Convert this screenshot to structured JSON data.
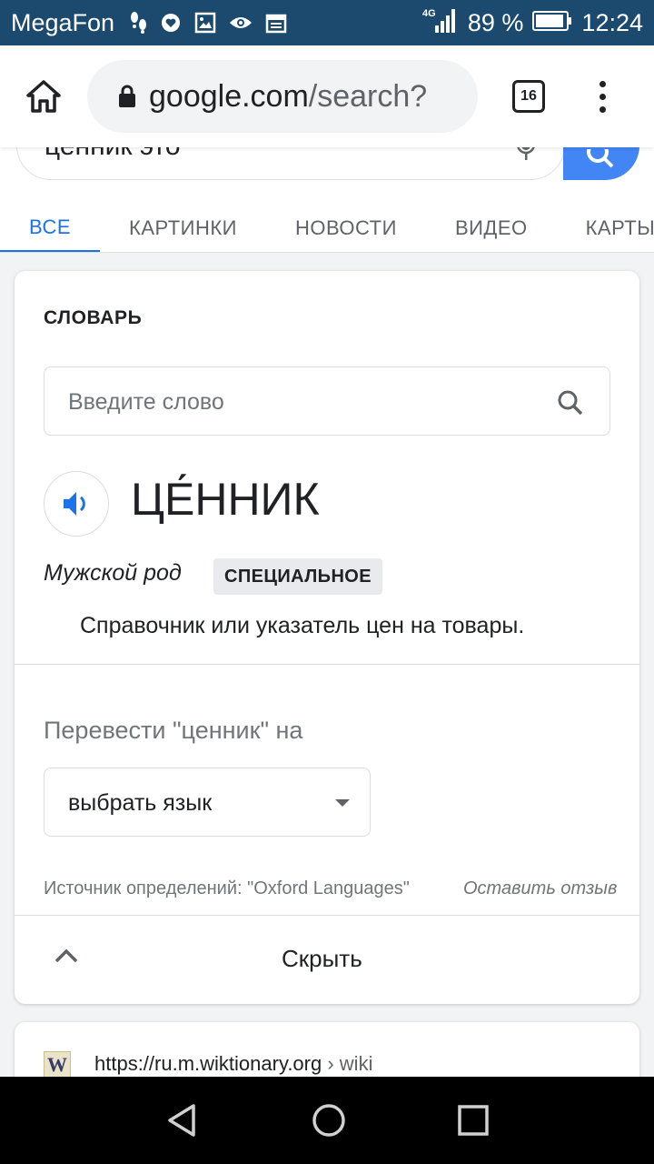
{
  "status_bar": {
    "carrier": "MegaFon",
    "network": "4G",
    "battery": "89 %",
    "time": "12:24",
    "icons": [
      "footsteps-icon",
      "heart-icon",
      "image-icon",
      "eye-icon",
      "calendar-icon",
      "signal-icon",
      "battery-icon"
    ]
  },
  "browser": {
    "url_host": "google.com",
    "url_path": "/search?",
    "tab_count": "16"
  },
  "search": {
    "query": "ценник это",
    "tabs": [
      {
        "label": "ВСЕ",
        "active": true
      },
      {
        "label": "КАРТИНКИ",
        "active": false
      },
      {
        "label": "НОВОСТИ",
        "active": false
      },
      {
        "label": "ВИДЕО",
        "active": false
      },
      {
        "label": "КАРТЫ",
        "active": false
      }
    ]
  },
  "dictionary": {
    "title": "СЛОВАРЬ",
    "input_placeholder": "Введите слово",
    "word": "ЦЕ́ННИК",
    "gender": "Мужской род",
    "register": "СПЕЦИАЛЬНОЕ",
    "definition": "Справочник или указатель цен на товары.",
    "translate_label": "Перевести \"ценник\" на",
    "language_select": "выбрать язык",
    "source": "Источник определений: \"Oxford Languages\"",
    "feedback": "Оставить отзыв",
    "collapse_label": "Скрыть"
  },
  "result": {
    "favicon_letter": "W",
    "url": "https://ru.m.wiktionary.org",
    "breadcrumb": "› wiki"
  },
  "colors": {
    "status_bar": "#1c4a6e",
    "accent": "#1a73e8",
    "search_button": "#4285f4"
  }
}
